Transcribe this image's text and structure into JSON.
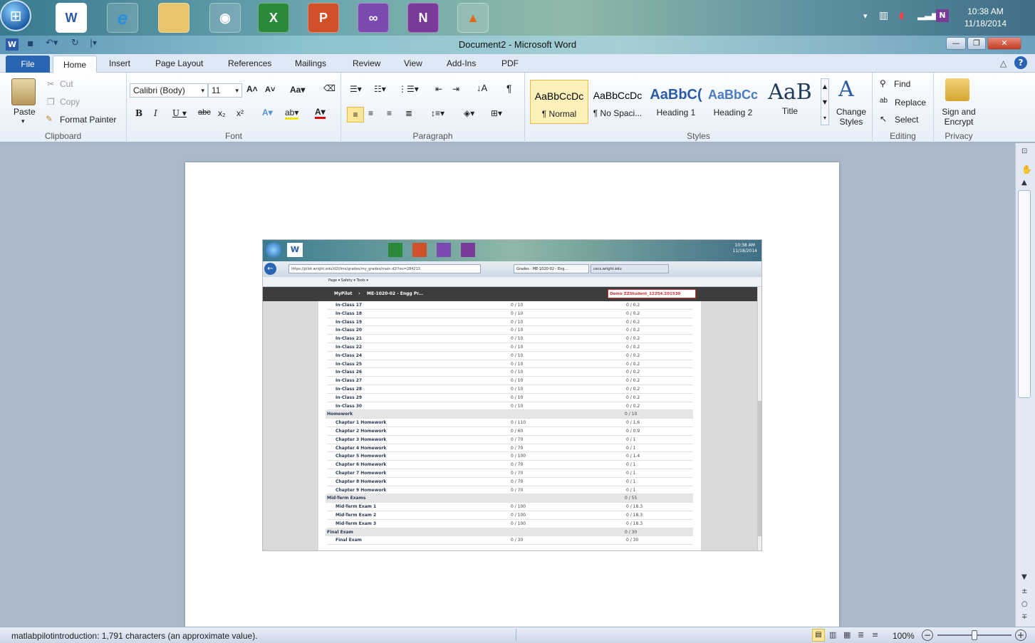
{
  "taskbar": {
    "apps": [
      "W",
      "e",
      "",
      "",
      "X",
      "P",
      "",
      "N",
      ""
    ],
    "tray_n": "N",
    "time": "10:38 AM",
    "date": "11/18/2014"
  },
  "window": {
    "title": "Document2 - Microsoft Word"
  },
  "ribbon_tabs": [
    "File",
    "Home",
    "Insert",
    "Page Layout",
    "References",
    "Mailings",
    "Review",
    "View",
    "Add-Ins",
    "PDF"
  ],
  "clipboard": {
    "paste": "Paste",
    "cut": "Cut",
    "copy": "Copy",
    "format_painter": "Format Painter",
    "label": "Clipboard"
  },
  "font": {
    "family": "Calibri (Body)",
    "size": "11",
    "label": "Font"
  },
  "paragraph": {
    "label": "Paragraph"
  },
  "styles": {
    "items": [
      {
        "sample": "AaBbCcDc",
        "name": "¶ Normal"
      },
      {
        "sample": "AaBbCcDc",
        "name": "¶ No Spaci..."
      },
      {
        "sample": "AaBbC(",
        "name": "Heading 1"
      },
      {
        "sample": "AaBbCc",
        "name": "Heading 2"
      },
      {
        "sample": "AaB",
        "name": "Title"
      }
    ],
    "change_styles": "Change Styles",
    "label": "Styles"
  },
  "editing": {
    "find": "Find",
    "replace": "Replace",
    "select": "Select",
    "label": "Editing"
  },
  "privacy": {
    "sign": "Sign and Encrypt",
    "label": "Privacy"
  },
  "embedded": {
    "url": "https://pilot.wright.edu/d2l/lms/grades/my_grades/main.d2l?ou=284213",
    "tab1": "Grades - ME-1020-02 - Eng...",
    "tab2": "cecs.wright.edu",
    "toolbar": "Page ▾  Safety ▾  Tools ▾",
    "nav_mypilot": "MyPilot",
    "nav_course": "ME-1020-02 - Engg Pr...",
    "nav_user": "Demo ZZStudent_12254.201530",
    "rows": [
      {
        "name": "In-Class 17",
        "points": "0 / 10",
        "weight": "0 / 0.2",
        "cat": false
      },
      {
        "name": "In-Class 18",
        "points": "0 / 10",
        "weight": "0 / 0.2",
        "cat": false
      },
      {
        "name": "In-Class 19",
        "points": "0 / 10",
        "weight": "0 / 0.2",
        "cat": false
      },
      {
        "name": "In-Class 20",
        "points": "0 / 10",
        "weight": "0 / 0.2",
        "cat": false
      },
      {
        "name": "In-Class 21",
        "points": "0 / 10",
        "weight": "0 / 0.2",
        "cat": false
      },
      {
        "name": "In-Class 22",
        "points": "0 / 10",
        "weight": "0 / 0.2",
        "cat": false
      },
      {
        "name": "In-Class 24",
        "points": "0 / 10",
        "weight": "0 / 0.2",
        "cat": false
      },
      {
        "name": "In-Class 25",
        "points": "0 / 10",
        "weight": "0 / 0.2",
        "cat": false
      },
      {
        "name": "In-Class 26",
        "points": "0 / 10",
        "weight": "0 / 0.2",
        "cat": false
      },
      {
        "name": "In-Class 27",
        "points": "0 / 10",
        "weight": "0 / 0.2",
        "cat": false
      },
      {
        "name": "In-Class 28",
        "points": "0 / 10",
        "weight": "0 / 0.2",
        "cat": false
      },
      {
        "name": "In-Class 29",
        "points": "0 / 10",
        "weight": "0 / 0.2",
        "cat": false
      },
      {
        "name": "In-Class 30",
        "points": "0 / 10",
        "weight": "0 / 0.2",
        "cat": false
      },
      {
        "name": "Homework",
        "points": "",
        "weight": "0 / 10",
        "cat": true
      },
      {
        "name": "Chapter 1 Homework",
        "points": "0 / 110",
        "weight": "0 / 1.6",
        "cat": false
      },
      {
        "name": "Chapter 2 Homework",
        "points": "0 / 60",
        "weight": "0 / 0.9",
        "cat": false
      },
      {
        "name": "Chapter 3 Homework",
        "points": "0 / 70",
        "weight": "0 / 1",
        "cat": false
      },
      {
        "name": "Chapter 4 Homework",
        "points": "0 / 70",
        "weight": "0 / 1",
        "cat": false
      },
      {
        "name": "Chapter 5 Homework",
        "points": "0 / 100",
        "weight": "0 / 1.4",
        "cat": false
      },
      {
        "name": "Chapter 6 Homework",
        "points": "0 / 70",
        "weight": "0 / 1",
        "cat": false
      },
      {
        "name": "Chapter 7 Homework",
        "points": "0 / 70",
        "weight": "0 / 1",
        "cat": false
      },
      {
        "name": "Chapter 8 Homework",
        "points": "0 / 70",
        "weight": "0 / 1",
        "cat": false
      },
      {
        "name": "Chapter 9 Homework",
        "points": "0 / 70",
        "weight": "0 / 1",
        "cat": false
      },
      {
        "name": "Mid-Term Exams",
        "points": "",
        "weight": "0 / 55",
        "cat": true
      },
      {
        "name": "Mid-Term Exam 1",
        "points": "0 / 100",
        "weight": "0 / 18.3",
        "cat": false
      },
      {
        "name": "Mid-Term Exam 2",
        "points": "0 / 100",
        "weight": "0 / 18.3",
        "cat": false
      },
      {
        "name": "Mid-Term Exam 3",
        "points": "0 / 100",
        "weight": "0 / 18.3",
        "cat": false
      },
      {
        "name": "Final Exam",
        "points": "",
        "weight": "0 / 30",
        "cat": true
      },
      {
        "name": "Final Exam",
        "points": "0 / 30",
        "weight": "0 / 30",
        "cat": false
      }
    ]
  },
  "status": {
    "text": "matlabpilotintroduction: 1,791 characters (an approximate value).",
    "zoom": "100%"
  }
}
